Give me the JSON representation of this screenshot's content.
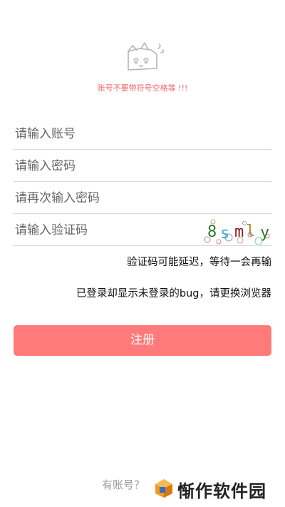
{
  "notice": "账号不要带符号空格等 !!!",
  "form": {
    "account_placeholder": "请输入账号",
    "password_placeholder": "请输入密码",
    "confirm_placeholder": "请再次输入密码",
    "captcha_placeholder": "请输入验证码",
    "captcha_code": [
      "8",
      "s",
      "m",
      "l",
      "y"
    ],
    "captcha_colors": [
      "#2a7a2a",
      "#3aa6d6",
      "#8b1a1a",
      "#b08a2a",
      "#2a7a2a"
    ]
  },
  "hints": {
    "captcha_delay": "验证码可能延迟，等待一会再输",
    "browser_bug": "已登录却显示未登录的bug，请更换浏览器"
  },
  "register_label": "注册",
  "have_account_link": "有账号？",
  "watermark": "惭作软件园",
  "colors": {
    "accent": "#ff7b7b",
    "notice": "#f06a6a"
  }
}
